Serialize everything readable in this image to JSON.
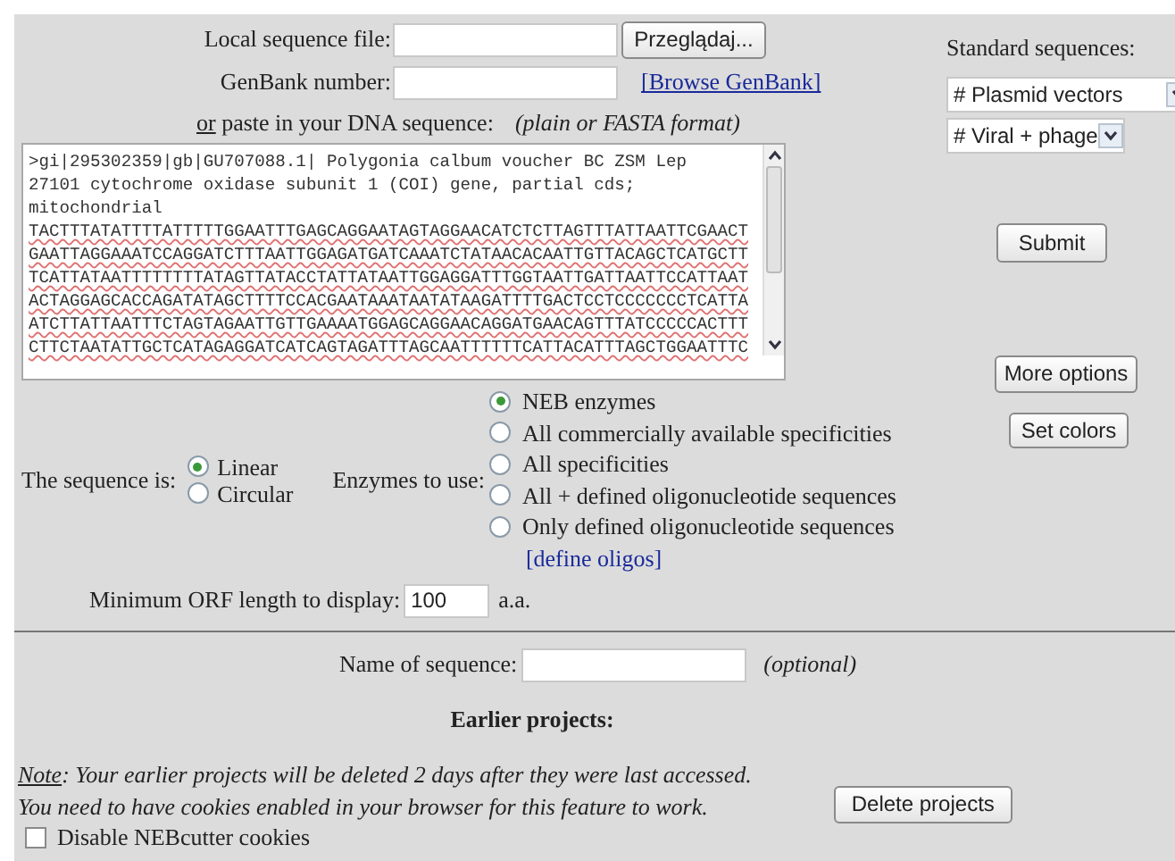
{
  "local_file": {
    "label": "Local sequence file:",
    "button": "Przeglądaj..."
  },
  "genbank": {
    "label": "GenBank number:",
    "link": "[Browse GenBank]"
  },
  "paste": {
    "or": "or",
    "label": " paste in your DNA sequence:",
    "hint": "(plain or FASTA format)"
  },
  "sequence_lines": [
    ">gi|295302359|gb|GU707088.1| Polygonia calbum voucher BC ZSM Lep",
    "27101 cytochrome oxidase subunit 1 (COI) gene, partial cds;",
    "mitochondrial",
    "TACTTTATATTTTATTTTTGGAATTTGAGCAGGAATAGTAGGAACATCTCTTAGTTTATTAATTCGAACT",
    "GAATTAGGAAATCCAGGATCTTTAATTGGAGATGATCAAATCTATAACACAATTGTTACAGCTCATGCTT",
    "TCATTATAATTTTTTTTATAGTTATACCTATTATAATTGGAGGATTTGGTAATTGATTAATTCCATTAAT",
    "ACTAGGAGCACCAGATATAGCTTTTCCACGAATAAATAATATAAGATTTTGACTCCTCCCCCCCTCATTA",
    "ATCTTATTAATTTCTAGTAGAATTGTTGAAAATGGAGCAGGAACAGGATGAACAGTTTATCCCCCACTTT",
    "CTTCTAATATTGCTCATAGAGGATCATCAGTAGATTTAGCAATTTTTTCATTACATTTAGCTGGAATTTC"
  ],
  "standard": {
    "label": "Standard sequences:",
    "selects": [
      "# Plasmid vectors",
      "# Viral + phage"
    ]
  },
  "buttons": {
    "submit": "Submit",
    "more": "More options",
    "colors": "Set colors"
  },
  "topology": {
    "label": "The sequence is:",
    "options": [
      {
        "label": "Linear",
        "selected": true
      },
      {
        "label": "Circular",
        "selected": false
      }
    ]
  },
  "enzymes": {
    "label": "Enzymes to use:",
    "options": [
      {
        "label": "NEB enzymes",
        "selected": true
      },
      {
        "label": "All commercially available specificities",
        "selected": false
      },
      {
        "label": "All specificities",
        "selected": false
      },
      {
        "label": "All + defined oligonucleotide sequences",
        "selected": false
      },
      {
        "label": "Only defined oligonucleotide sequences",
        "selected": false
      }
    ],
    "link": "[define oligos]"
  },
  "orf": {
    "label": "Minimum ORF length to display:",
    "value": "100",
    "unit": "a.a."
  },
  "name": {
    "label": "Name of sequence:",
    "hint": "(optional)"
  },
  "earlier": {
    "title": "Earlier projects:",
    "note_lead": "Note",
    "note": ": Your earlier projects will be deleted 2 days after they were last accessed.",
    "note2": "You need to have cookies enabled in your browser for this feature to work.",
    "delete": "Delete projects"
  },
  "cookies": {
    "label": "Disable NEBcutter cookies",
    "checked": false
  }
}
